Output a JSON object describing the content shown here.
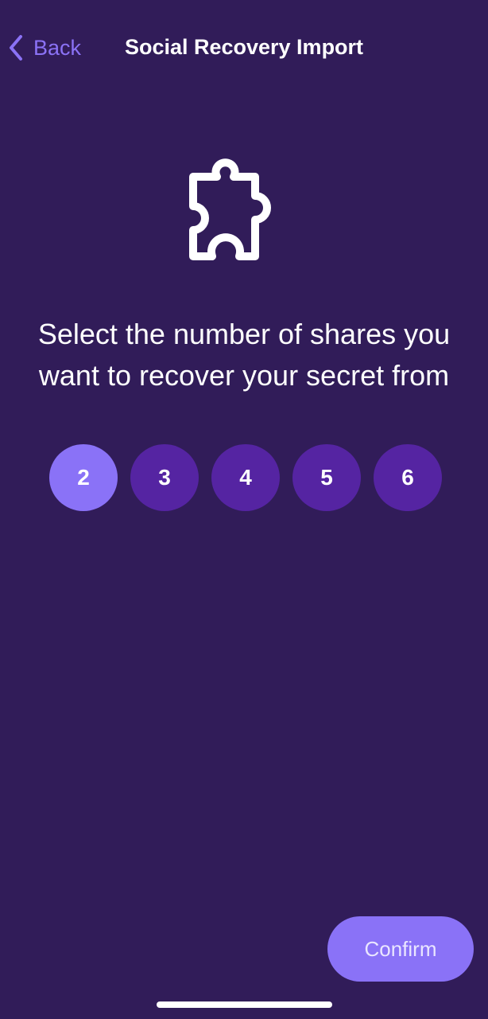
{
  "nav": {
    "back_label": "Back",
    "title": "Social Recovery Import"
  },
  "icons": {
    "back": "chevron-left-icon",
    "hero": "puzzle-piece-icon"
  },
  "prompt": {
    "line1": "Select the number of shares you",
    "line2": "want to recover your secret from"
  },
  "shares": {
    "options": [
      "2",
      "3",
      "4",
      "5",
      "6"
    ],
    "selected": "2"
  },
  "actions": {
    "confirm_label": "Confirm"
  },
  "colors": {
    "background": "#311c59",
    "accent": "#8a72f7",
    "option": "#5524a2",
    "text": "#ffffff"
  }
}
